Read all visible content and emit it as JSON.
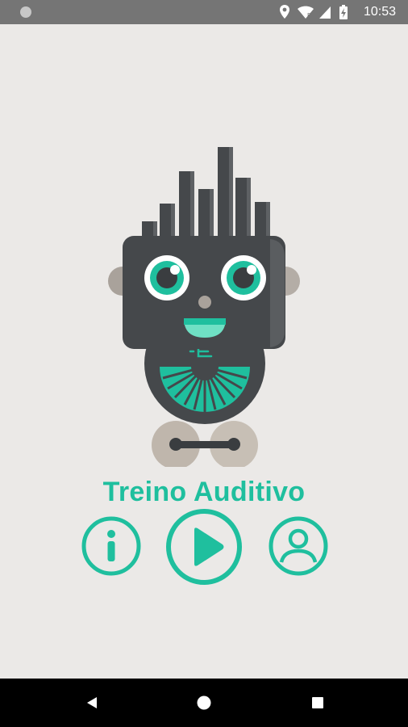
{
  "status_bar": {
    "time": "10:53",
    "icons": [
      "notification-dot-icon",
      "location-icon",
      "wifi-icon",
      "signal-icon",
      "battery-icon"
    ]
  },
  "app": {
    "title": "Treino Auditivo",
    "accent_color": "#1fbf9e",
    "background_color": "#ebe9e7",
    "robot_mascot": "robot-logo"
  },
  "actions": [
    {
      "name": "info-button",
      "icon": "info-icon"
    },
    {
      "name": "play-button",
      "icon": "play-icon"
    },
    {
      "name": "profile-button",
      "icon": "user-icon"
    }
  ],
  "nav_bar": {
    "buttons": [
      "back-icon",
      "home-icon",
      "recents-icon"
    ]
  }
}
